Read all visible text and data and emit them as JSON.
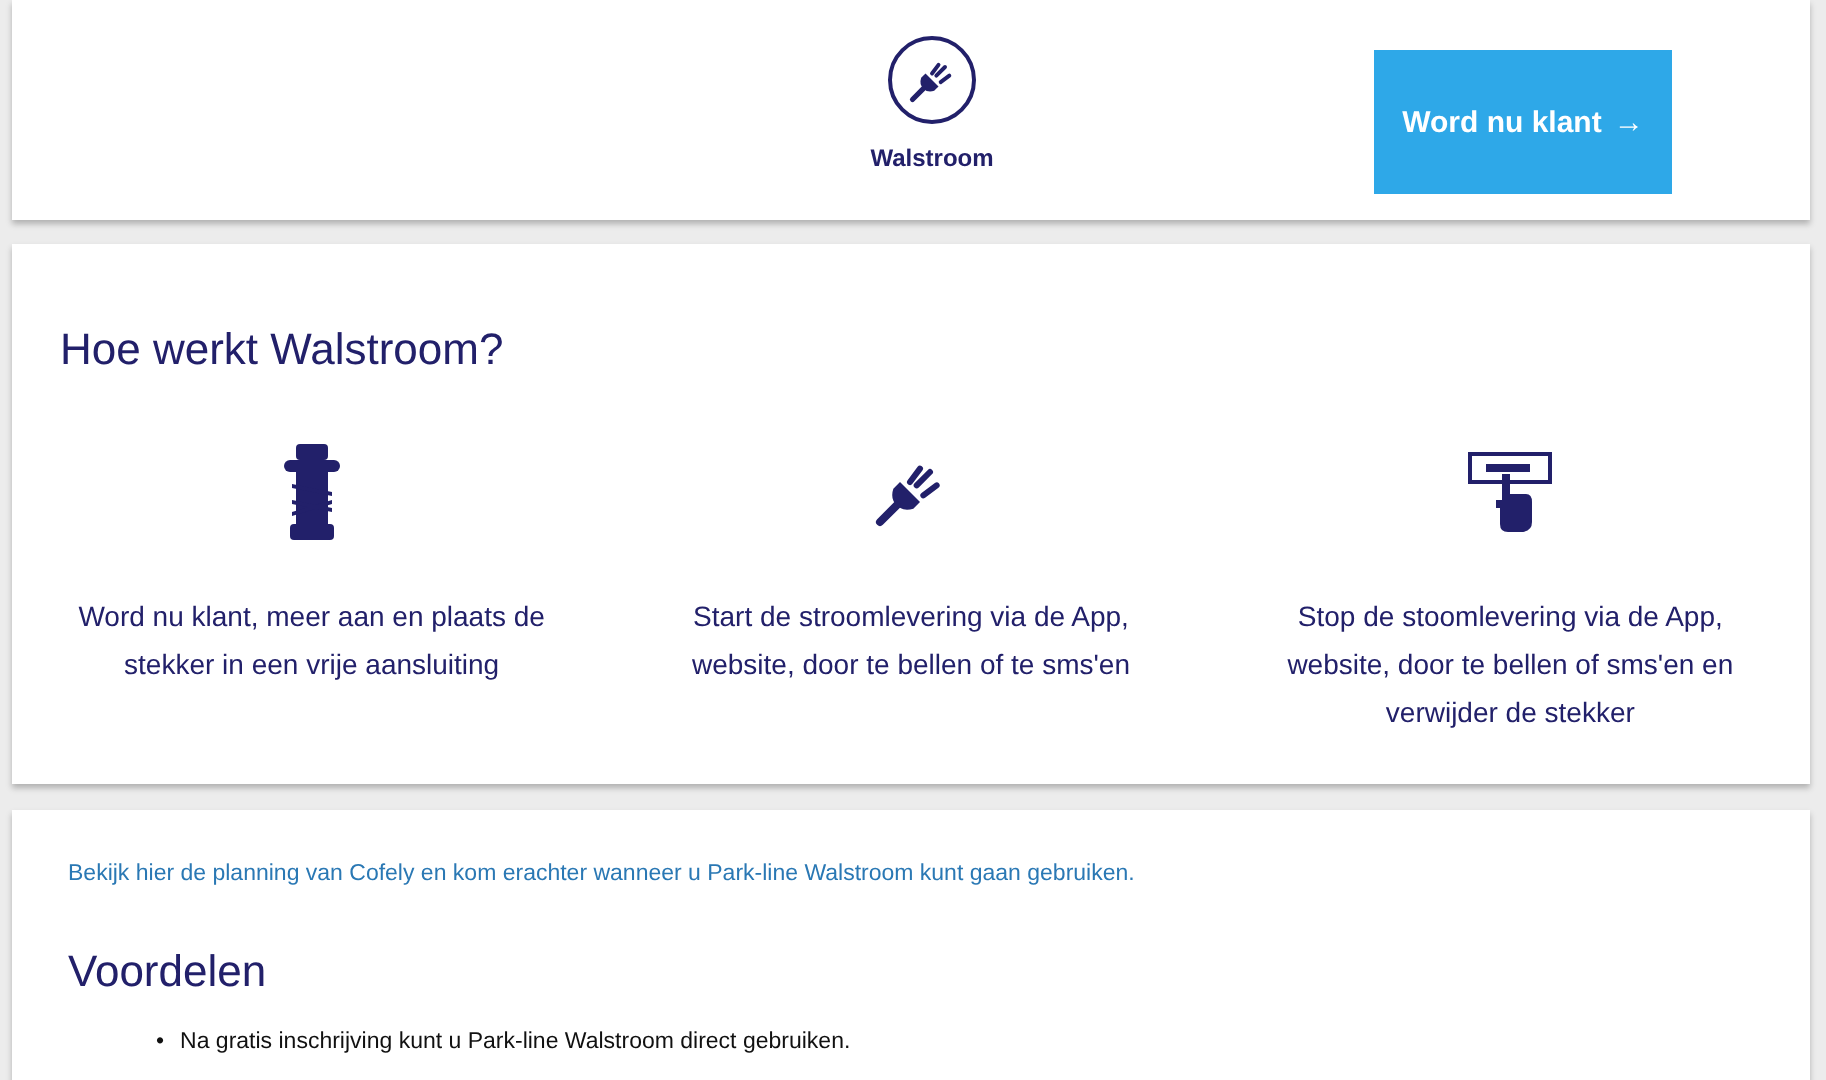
{
  "header": {
    "service_label": "Walstroom",
    "cta_button": "Word nu klant",
    "cta_arrow": "→"
  },
  "how_it_works": {
    "title": "Hoe werkt Walstroom?",
    "steps": [
      {
        "kind": "bollard",
        "text": "Word nu klant, meer aan en plaats de stekker in een vrije aansluiting"
      },
      {
        "kind": "plug",
        "text": "Start de stroomlevering via de App, website, door te bellen of te sms'en"
      },
      {
        "kind": "stop",
        "text": "Stop de stoomlevering via de App, website, door te bellen of sms'en en verwijder de stekker"
      }
    ]
  },
  "info": {
    "link": "Bekijk hier de planning van Cofely en kom erachter wanneer u Park-line Walstroom kunt gaan gebruiken.",
    "title": "Voordelen",
    "bullets": [
      {
        "marker": "•",
        "text": "Na gratis inschrijving kunt u Park-line Walstroom direct gebruiken."
      }
    ]
  }
}
